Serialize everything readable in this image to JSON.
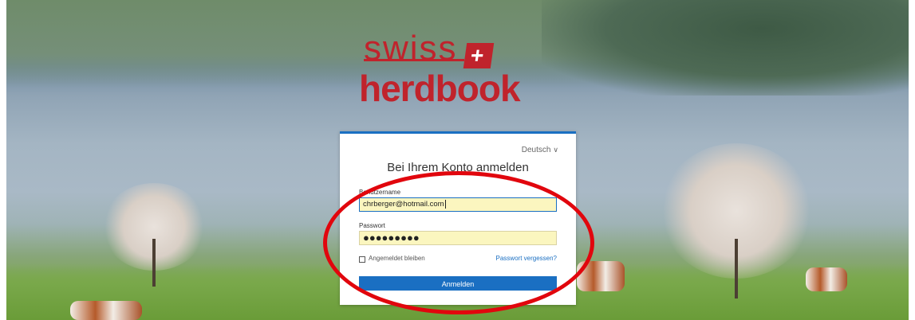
{
  "logo": {
    "line1": "swiss",
    "flag_symbol": "+",
    "line2": "herdbook"
  },
  "login": {
    "language": "Deutsch",
    "title": "Bei Ihrem Konto anmelden",
    "username_label": "Benutzername",
    "username_value": "chrberger@hotmail.com",
    "password_label": "Passwort",
    "password_value": "●●●●●●●●●",
    "remember_label": "Angemeldet bleiben",
    "remember_checked": false,
    "forgot_link": "Passwort vergessen?",
    "submit_label": "Anmelden"
  },
  "colors": {
    "brand": "#c0232c",
    "accent": "#1a6fc2",
    "autofill": "#fbf6bf",
    "annotation": "#e1060d"
  }
}
